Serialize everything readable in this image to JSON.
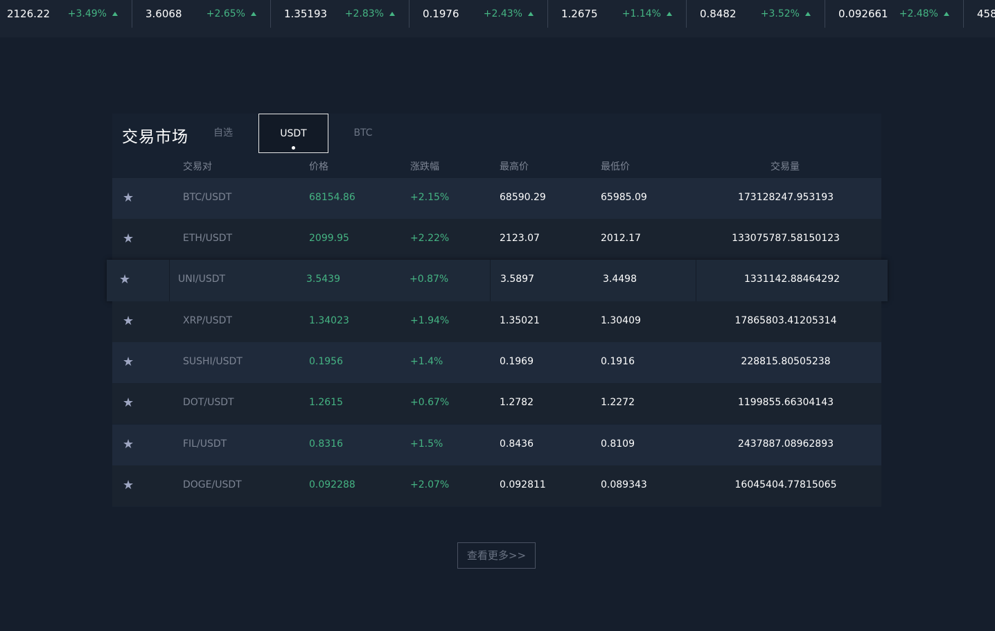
{
  "ticker": [
    {
      "price": "2126.22",
      "change": "+3.49%"
    },
    {
      "price": "3.6068",
      "change": "+2.65%"
    },
    {
      "price": "1.35193",
      "change": "+2.83%"
    },
    {
      "price": "0.1976",
      "change": "+2.43%"
    },
    {
      "price": "1.2675",
      "change": "+1.14%"
    },
    {
      "price": "0.8482",
      "change": "+3.52%"
    },
    {
      "price": "0.092661",
      "change": "+2.48%"
    },
    {
      "price": "458",
      "change": ""
    }
  ],
  "market": {
    "title": "交易市场",
    "tabs": {
      "favorites": "自选",
      "usdt": "USDT",
      "btc": "BTC"
    },
    "columns": {
      "pair": "交易对",
      "price": "价格",
      "change": "涨跌幅",
      "high": "最高价",
      "low": "最低价",
      "volume": "交易量"
    },
    "rows": [
      {
        "pair": "BTC/USDT",
        "price": "68154.86",
        "change": "+2.15%",
        "high": "68590.29",
        "low": "65985.09",
        "volume": "173128247.953193"
      },
      {
        "pair": "ETH/USDT",
        "price": "2099.95",
        "change": "+2.22%",
        "high": "2123.07",
        "low": "2012.17",
        "volume": "133075787.58150123"
      },
      {
        "pair": "UNI/USDT",
        "price": "3.5439",
        "change": "+0.87%",
        "high": "3.5897",
        "low": "3.4498",
        "volume": "1331142.88464292"
      },
      {
        "pair": "XRP/USDT",
        "price": "1.34023",
        "change": "+1.94%",
        "high": "1.35021",
        "low": "1.30409",
        "volume": "17865803.41205314"
      },
      {
        "pair": "SUSHI/USDT",
        "price": "0.1956",
        "change": "+1.4%",
        "high": "0.1969",
        "low": "0.1916",
        "volume": "228815.80505238"
      },
      {
        "pair": "DOT/USDT",
        "price": "1.2615",
        "change": "+0.67%",
        "high": "1.2782",
        "low": "1.2272",
        "volume": "1199855.66304143"
      },
      {
        "pair": "FIL/USDT",
        "price": "0.8316",
        "change": "+1.5%",
        "high": "0.8436",
        "low": "0.8109",
        "volume": "2437887.08962893"
      },
      {
        "pair": "DOGE/USDT",
        "price": "0.092288",
        "change": "+2.07%",
        "high": "0.092811",
        "low": "0.089343",
        "volume": "16045404.77815065"
      }
    ],
    "more_label": "查看更多>>"
  },
  "colors": {
    "up": "#45b483",
    "background": "#151e2c",
    "panel": "#172130"
  },
  "icons": {
    "favorite": "star-icon",
    "trend": "arrow-up-icon"
  }
}
